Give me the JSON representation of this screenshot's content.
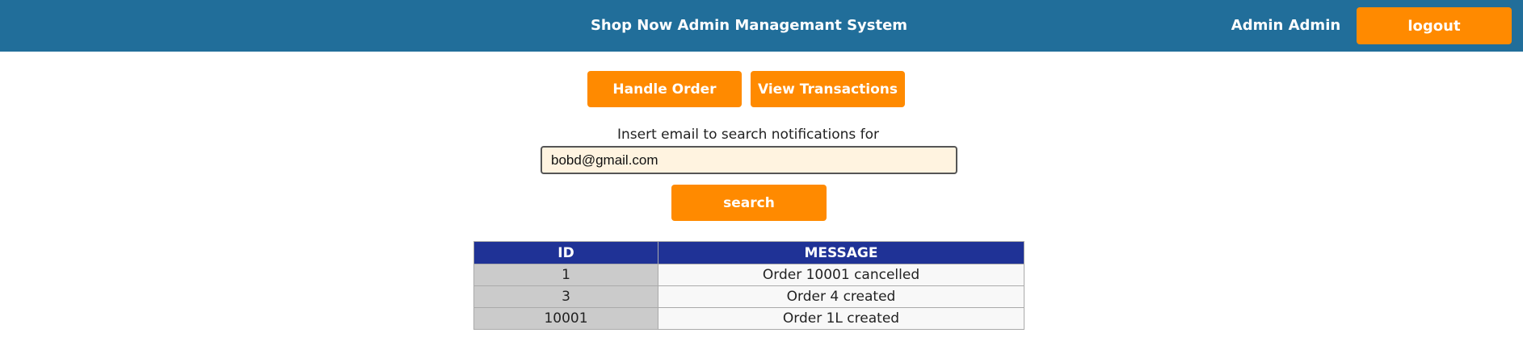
{
  "header": {
    "title": "Shop Now Admin Managemant System",
    "user_name": "Admin Admin",
    "logout_label": "logout"
  },
  "nav": {
    "handle_order_label": "Handle Order",
    "view_transactions_label": "View Transactions"
  },
  "search": {
    "label": "Insert email to search notifications for",
    "value": "bobd@gmail.com",
    "button_label": "search"
  },
  "table": {
    "columns": [
      "ID",
      "MESSAGE"
    ],
    "rows": [
      {
        "id": "1",
        "message": "Order 10001 cancelled"
      },
      {
        "id": "3",
        "message": "Order 4 created"
      },
      {
        "id": "10001",
        "message": "Order 1L created"
      }
    ]
  },
  "colors": {
    "header_bg": "#216e9a",
    "accent_orange": "#ff8a00",
    "table_header_bg": "#1f3296",
    "input_bg": "#fff3e0"
  }
}
